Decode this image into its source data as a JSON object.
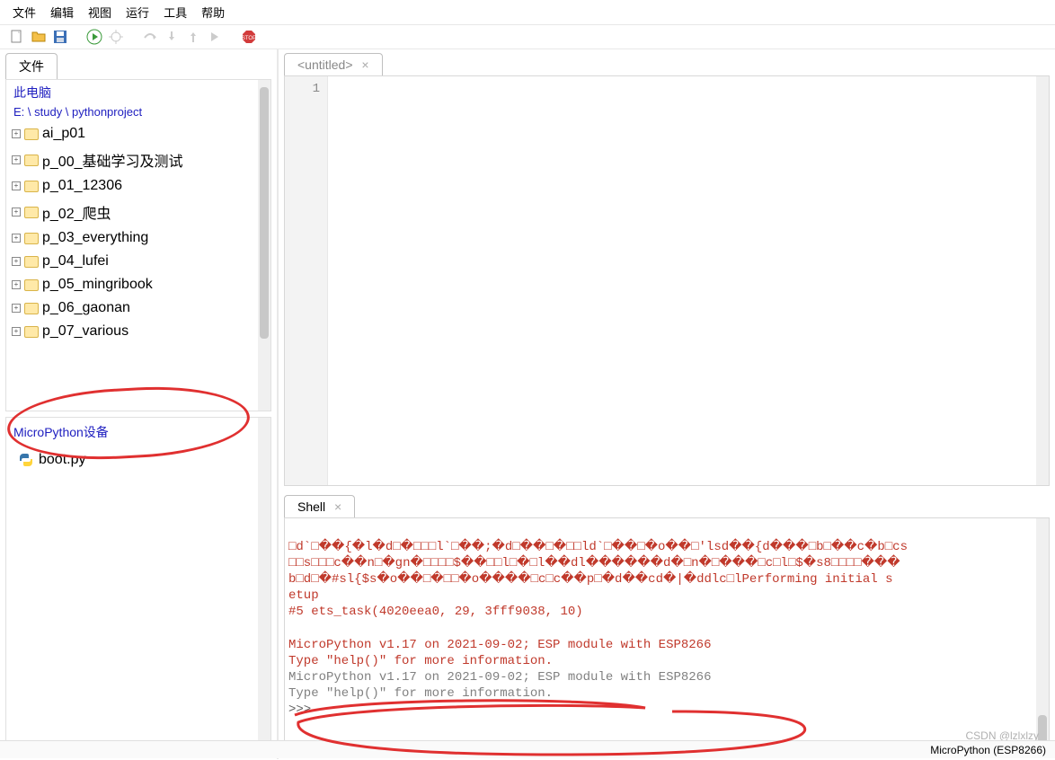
{
  "menu": [
    "文件",
    "编辑",
    "视图",
    "运行",
    "工具",
    "帮助"
  ],
  "files_tab": "文件",
  "files_header": "此电脑",
  "files_path": "E: \\ study \\ pythonproject",
  "tree": [
    "ai_p01",
    "p_00_基础学习及测试",
    "p_01_12306",
    "p_02_爬虫",
    "p_03_everything",
    "p_04_lufei",
    "p_05_mingribook",
    "p_06_gaonan",
    "p_07_various"
  ],
  "mp_header": "MicroPython设备",
  "mp_file": "boot.py",
  "editor_tab": "<untitled>",
  "gutter_line": "1",
  "shell_tab": "Shell",
  "shell": {
    "l1": "□d`□��{�l�d□�□□□l`□��;�d□��□�□□ld`□��□�o��□'lsd��{d���□b□��c�b□cs",
    "l2": "□□s□□□c��n□�gn�□□□□$��□□l□�□l��dl������d�□n�□���□c□l□$�s8□□□□���",
    "l3": "b□d□�#sl{$s�o��□�□□�o����□c□c��p□�d��cd�|�ddlc□lPerforming initial s",
    "l4": "etup",
    "l5": "#5 ets_task(4020eea0, 29, 3fff9038, 10)",
    "l6": "MicroPython v1.17 on 2021-09-02; ESP module with ESP8266",
    "l7": "Type \"help()\" for more information.",
    "l8": "MicroPython v1.17 on 2021-09-02; ESP module with ESP8266",
    "l9": "Type \"help()\" for more information.",
    "prompt": ">>>"
  },
  "statusbar": "MicroPython (ESP8266)",
  "watermark": "CSDN @lzlxlzy"
}
